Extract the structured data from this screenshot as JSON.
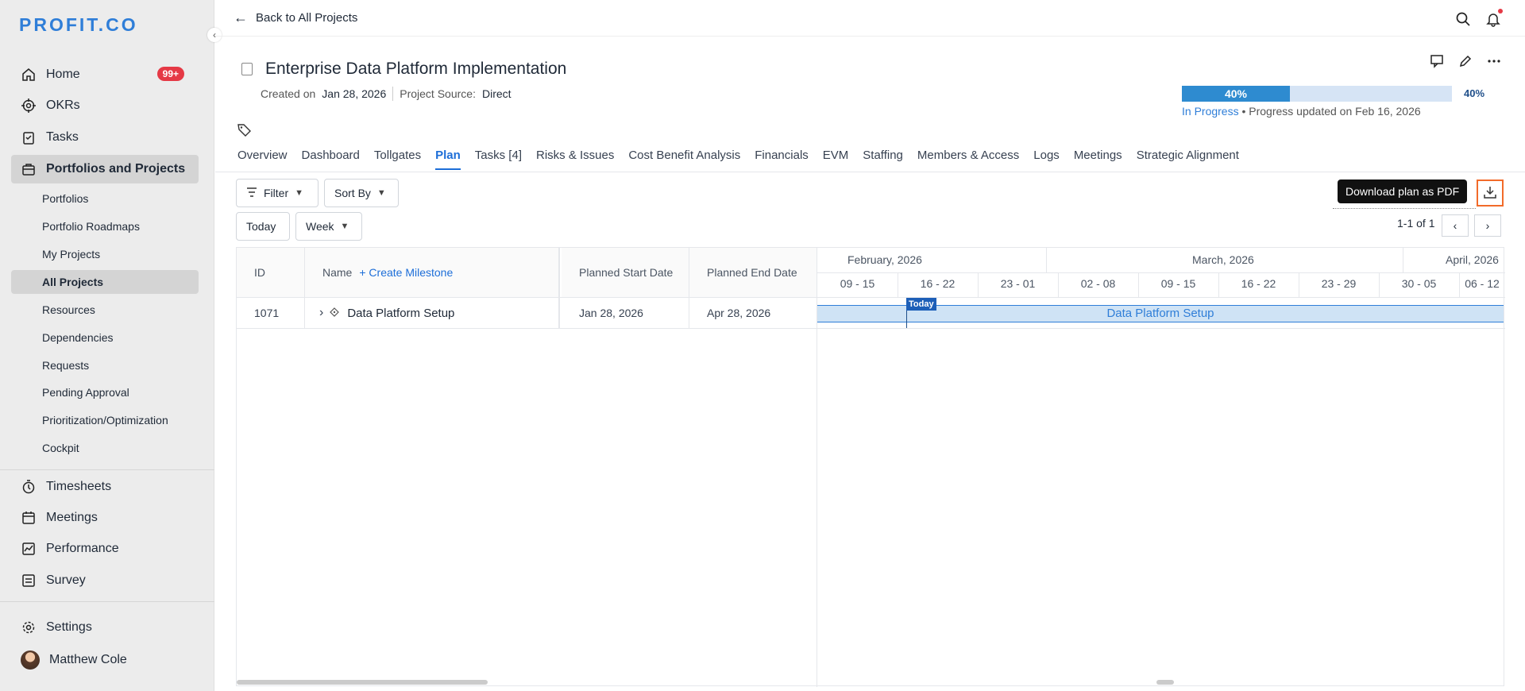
{
  "sidebar": {
    "logo": "PROFIT.CO",
    "home": {
      "label": "Home",
      "badge": "99+"
    },
    "okrs": "OKRs",
    "tasks": "Tasks",
    "portfolios": "Portfolios and Projects",
    "sub": [
      "Portfolios",
      "Portfolio Roadmaps",
      "My Projects",
      "All Projects",
      "Resources",
      "Dependencies",
      "Requests",
      "Pending Approval",
      "Prioritization/Optimization",
      "Cockpit"
    ],
    "timesheets": "Timesheets",
    "meetings": "Meetings",
    "performance": "Performance",
    "survey": "Survey",
    "settings": "Settings",
    "user": "Matthew Cole"
  },
  "topbar": {
    "back": "Back to All Projects"
  },
  "project": {
    "title": "Enterprise Data Platform Implementation",
    "created_label": "Created on",
    "created_value": "Jan 28, 2026",
    "source_label": "Project Source:",
    "source_value": "Direct",
    "progress": {
      "percent": 40,
      "bar_label": "40%",
      "side_label": "40%",
      "status": "In Progress",
      "updated": "• Progress updated on Feb 16, 2026"
    }
  },
  "tabs": [
    "Overview",
    "Dashboard",
    "Tollgates",
    "Plan",
    "Tasks [4]",
    "Risks & Issues",
    "Cost Benefit Analysis",
    "Financials",
    "EVM",
    "Staffing",
    "Members & Access",
    "Logs",
    "Meetings",
    "Strategic Alignment"
  ],
  "toolbar": {
    "filter": "Filter",
    "sort": "Sort By",
    "today": "Today",
    "week": "Week",
    "tooltip": "Download plan as PDF",
    "pager": "1-1 of 1"
  },
  "grid": {
    "headers": {
      "id": "ID",
      "name": "Name",
      "create": "+ Create Milestone",
      "start": "Planned Start Date",
      "end": "Planned End Date"
    },
    "rows": [
      {
        "id": "1071",
        "name": "Data Platform Setup",
        "start": "Jan 28, 2026",
        "end": "Apr 28, 2026"
      }
    ],
    "months": [
      "February, 2026",
      "March, 2026",
      "April, 2026"
    ],
    "weeks": [
      "09 - 15",
      "16 - 22",
      "23 - 01",
      "02 - 08",
      "09 - 15",
      "16 - 22",
      "23 - 29",
      "30 - 05",
      "06 - 12"
    ],
    "today_label": "Today",
    "bar_label": "Data Platform Setup"
  },
  "colors": {
    "accent": "#1d6ed8",
    "badge": "#e53945",
    "highlight": "#f26b2a"
  }
}
